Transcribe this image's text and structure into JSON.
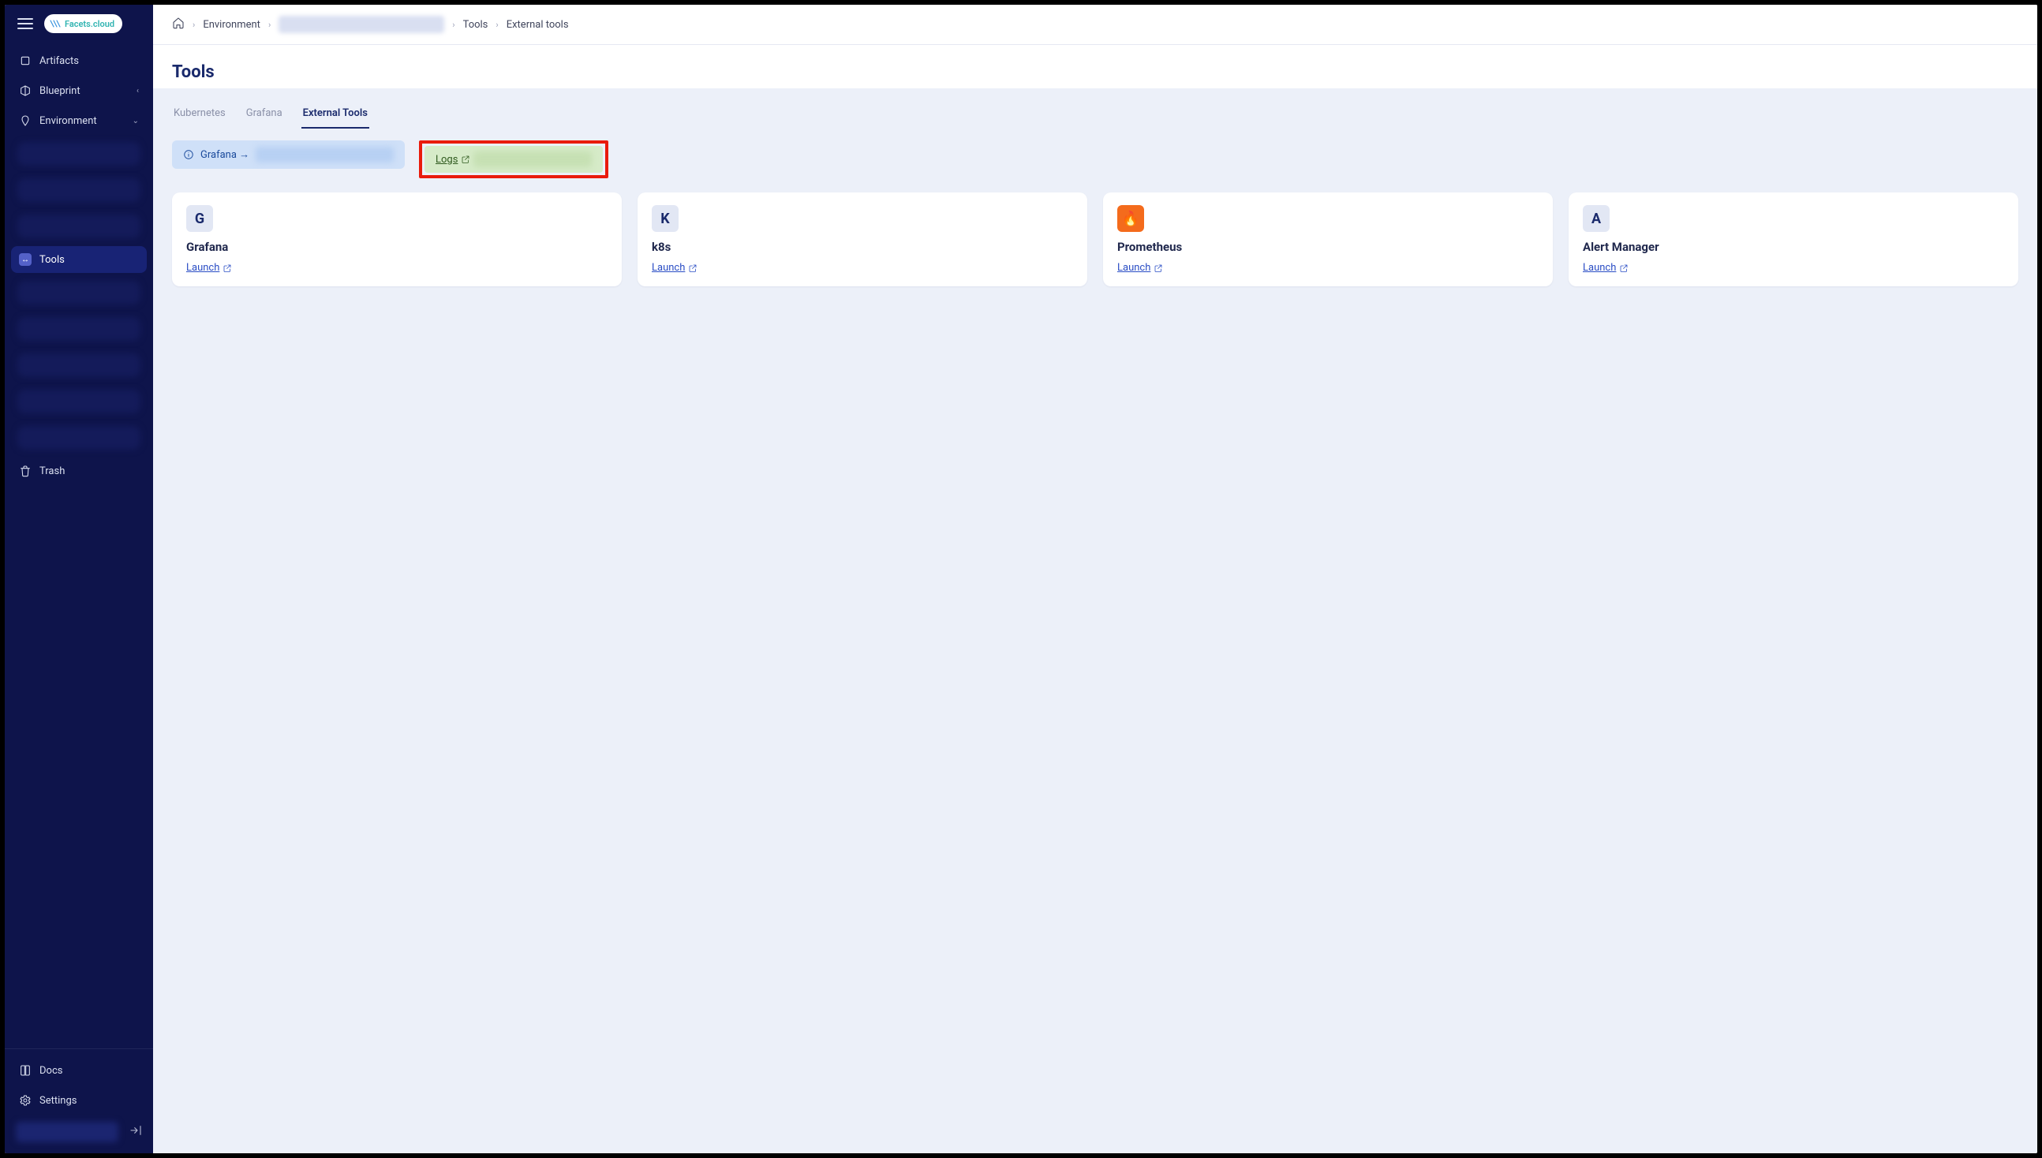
{
  "logo_text": "Facets.cloud",
  "sidebar": {
    "items": [
      {
        "label": "Artifacts"
      },
      {
        "label": "Blueprint"
      },
      {
        "label": "Environment"
      },
      {
        "label": "Tools"
      },
      {
        "label": "Trash"
      }
    ],
    "bottom": [
      {
        "label": "Docs"
      },
      {
        "label": "Settings"
      }
    ]
  },
  "breadcrumb": {
    "env": "Environment",
    "tools": "Tools",
    "external": "External tools"
  },
  "page_title": "Tools",
  "tabs": [
    {
      "label": "Kubernetes",
      "active": false
    },
    {
      "label": "Grafana",
      "active": false
    },
    {
      "label": "External Tools",
      "active": true
    }
  ],
  "pills": {
    "grafana": "Grafana →",
    "logs": "Logs"
  },
  "cards": [
    {
      "badge": "G",
      "title": "Grafana",
      "link": "Launch "
    },
    {
      "badge": "K",
      "title": "k8s",
      "link": "Launch "
    },
    {
      "badge": "🔥",
      "title": "Prometheus",
      "link": "Launch ",
      "orange": true
    },
    {
      "badge": "A",
      "title": "Alert Manager",
      "link": "Launch "
    }
  ]
}
